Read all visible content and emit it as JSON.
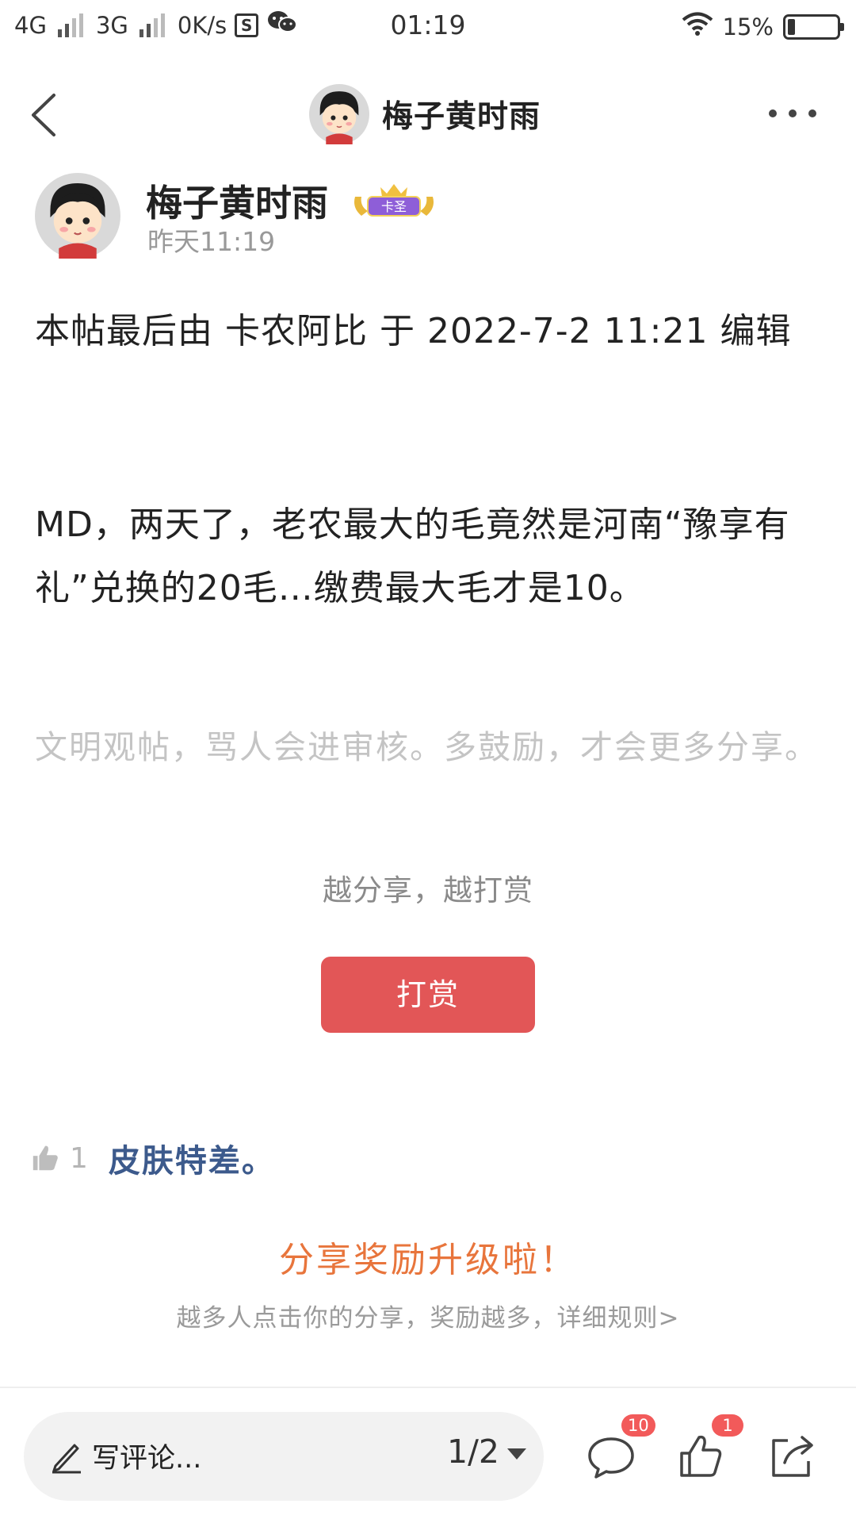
{
  "status_bar": {
    "network_1": "4G",
    "network_2": "3G",
    "speed": "0K/s",
    "time": "01:19",
    "battery": "15%",
    "battery_level": 0.15
  },
  "nav": {
    "title": "梅子黄时雨"
  },
  "author": {
    "name": "梅子黄时雨",
    "badge_label": "卡圣",
    "time": "昨天11:19"
  },
  "post": {
    "edit_note": "本帖最后由 卡农阿比 于 2022-7-2 11:21 编辑",
    "body": "MD，两天了，老农最大的毛竟然是河南“豫享有礼”兑换的20毛…缴费最大毛才是10。",
    "civil_note": "文明观帖，骂人会进审核。多鼓励，才会更多分享。"
  },
  "reward": {
    "caption": "越分享，越打赏",
    "button_label": "打赏"
  },
  "hot_comment": {
    "likes": "1",
    "text": "皮肤特差。"
  },
  "share": {
    "title": "分享奖励升级啦！",
    "subtitle": "越多人点击你的分享，奖励越多，详细规则>"
  },
  "bottom_bar": {
    "comment_placeholder": "写评论...",
    "page": "1/2",
    "comments_badge": "10",
    "likes_badge": "1"
  },
  "colors": {
    "accent_red": "#e25657",
    "share_orange": "#e8753c",
    "comment_blue": "#3c5a8c",
    "badge_red": "#f25a5a"
  },
  "icons": [
    "back-icon",
    "more-icon",
    "avatar",
    "rank-badge-icon",
    "thumb-up-icon",
    "pen-icon",
    "dropdown-arrow-icon",
    "comment-icon",
    "like-icon",
    "share-icon",
    "wifi-icon",
    "wechat-icon",
    "battery-icon"
  ]
}
